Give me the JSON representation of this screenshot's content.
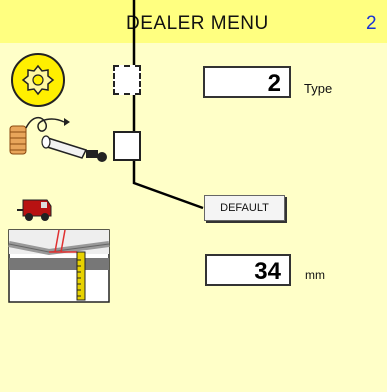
{
  "header": {
    "title": "DEALER MENU",
    "page_number": "2"
  },
  "type_row": {
    "value": "2",
    "unit": "Type",
    "checked": false
  },
  "winder_row": {
    "checked": false
  },
  "default_button": {
    "label": "DEFAULT"
  },
  "length_row": {
    "value": "34",
    "unit": "mm"
  },
  "icons": {
    "knotter": "knotter-gear-icon",
    "twine": "twine-spool-icon",
    "baler": "baler-icon",
    "measure": "needle-measure-icon"
  },
  "colors": {
    "background": "#ffffc8",
    "header": "#ffff80",
    "page_number": "#1a34d6",
    "callout_line": "#000000"
  }
}
